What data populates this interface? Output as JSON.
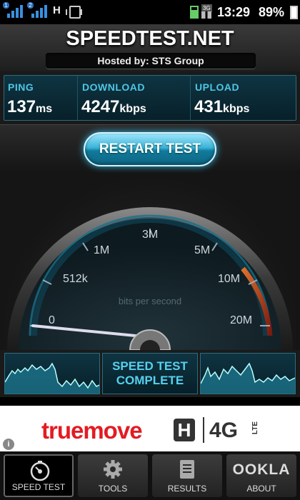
{
  "status_bar": {
    "sim1": "1",
    "sim2": "2",
    "network_h": "H",
    "network_3g": "3G",
    "time": "13:29",
    "battery": "89%",
    "icons": [
      "signal-bars-icon",
      "signal-bars-icon",
      "h-network-icon",
      "vibrate-icon",
      "battery-charging-icon",
      "3g-icon",
      "battery-icon"
    ]
  },
  "header": {
    "logo": "SPEEDTEST.NET",
    "hosted_by": "Hosted by: STS Group"
  },
  "results": {
    "ping_label": "PING",
    "ping_value": "137",
    "ping_unit": "ms",
    "download_label": "DOWNLOAD",
    "download_value": "4247",
    "download_unit": "kbps",
    "upload_label": "UPLOAD",
    "upload_value": "431",
    "upload_unit": "kbps"
  },
  "restart_button": "RESTART TEST",
  "gauge": {
    "labels": [
      "0",
      "512k",
      "1M",
      "3M",
      "5M",
      "10M",
      "20M"
    ],
    "unit_caption": "bits per second",
    "needle_value": "0"
  },
  "graph_panel": {
    "status_line1": "SPEED TEST",
    "status_line2": "COMPLETE"
  },
  "ad": {
    "brand": "truemove",
    "h_badge": "H",
    "network": "4G",
    "lte": "LTE",
    "info": "i"
  },
  "tabs": [
    {
      "label": "SPEED TEST",
      "icon": "speedometer-icon",
      "active": true
    },
    {
      "label": "TOOLS",
      "icon": "gear-icon",
      "active": false
    },
    {
      "label": "RESULTS",
      "icon": "document-list-icon",
      "active": false
    },
    {
      "label": "ABOUT",
      "brand": "OOKLA",
      "icon": "ookla-logo",
      "active": false
    }
  ],
  "colors": {
    "accent": "#4cc7e6",
    "panel": "#0f3442",
    "ad_red": "#e31b23"
  }
}
